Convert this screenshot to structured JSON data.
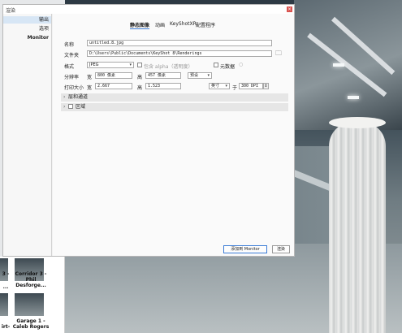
{
  "dialog": {
    "title": "渲染",
    "close_icon": "close-icon"
  },
  "sidebar": {
    "items": [
      {
        "label": "输出"
      },
      {
        "label": "选项"
      },
      {
        "label": "Monitor"
      }
    ]
  },
  "tabs": [
    {
      "label": "静态图像"
    },
    {
      "label": "动画"
    },
    {
      "label": "KeyShotXR"
    },
    {
      "label": "配置程序"
    }
  ],
  "form": {
    "name_label": "名称",
    "name_value": "untitled.8.jpg",
    "folder_label": "文件夹",
    "folder_value": "D:\\Users\\Public\\Documents\\KeyShot 8\\Renderings",
    "folder_icon": "folder-icon",
    "format_label": "格式",
    "format_value": "JPEG",
    "alpha_label": "包含 alpha（透明度）",
    "metadata_label": "元数据",
    "resolution_label": "分辨率",
    "width_label": "宽",
    "width_value": "800 像素",
    "height_label": "高",
    "height_value": "457 像素",
    "preset_value": "预设",
    "print_size_label": "打印大小",
    "print_width_label": "宽",
    "print_width_value": "2.667",
    "print_height_label": "高",
    "print_height_value": "1.523",
    "unit_value": "英寸",
    "at_label": "于",
    "dpi_value": "300 DPI"
  },
  "sections": [
    {
      "label": "层和通道"
    },
    {
      "label": "区域"
    }
  ],
  "buttons": {
    "add_monitor": "添加到 Monitor",
    "render": "渲染"
  },
  "thumbnails": {
    "items": [
      {
        "label": "3 -"
      },
      {
        "label": "Corridor 3 - Phil Desforge..."
      },
      {
        "label": "..."
      },
      {
        "label": "Garage 1 - Caleb Rogers"
      },
      {
        "label": "irt-"
      }
    ]
  }
}
